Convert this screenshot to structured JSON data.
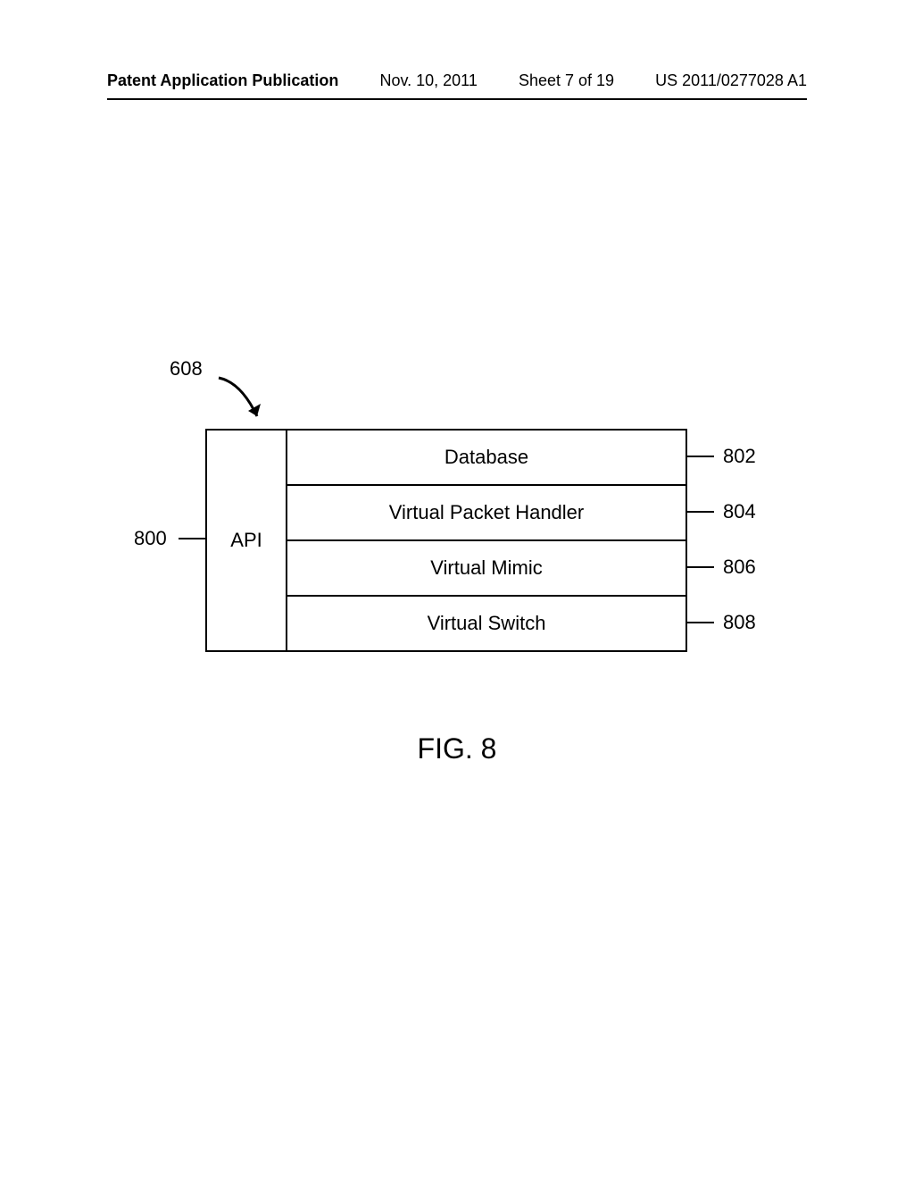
{
  "header": {
    "left": "Patent Application Publication",
    "date": "Nov. 10, 2011",
    "sheet": "Sheet 7 of 19",
    "pubno": "US 2011/0277028 A1"
  },
  "diagram": {
    "pointer_ref": "608",
    "api_label": "API",
    "api_ref": "800",
    "rows": [
      {
        "label": "Database",
        "ref": "802"
      },
      {
        "label": "Virtual Packet Handler",
        "ref": "804"
      },
      {
        "label": "Virtual Mimic",
        "ref": "806"
      },
      {
        "label": "Virtual Switch",
        "ref": "808"
      }
    ],
    "figure_caption": "FIG. 8"
  }
}
